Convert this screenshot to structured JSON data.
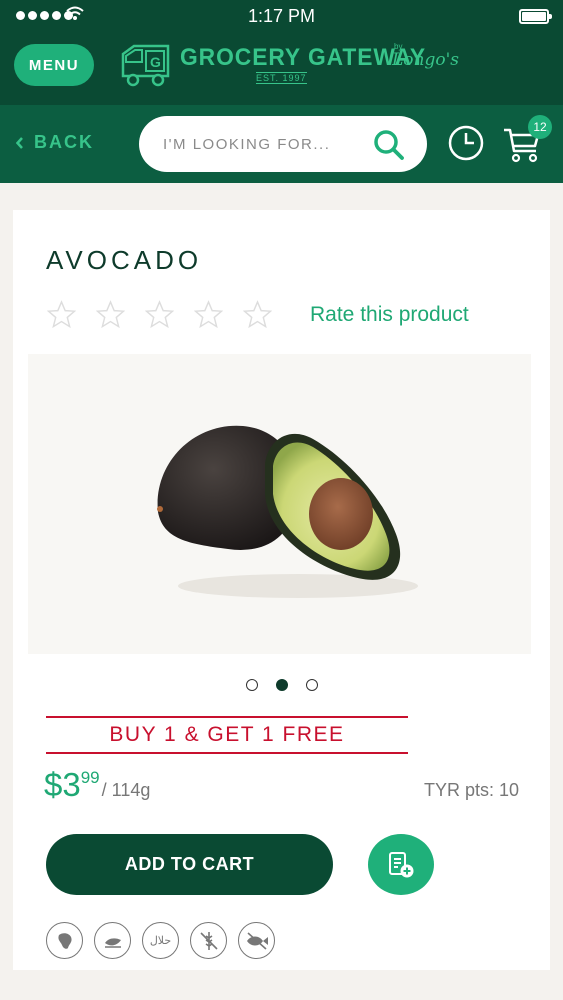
{
  "status_bar": {
    "time": "1:17 PM"
  },
  "header": {
    "menu_label": "MENU",
    "logo": {
      "title": "GROCERY GATEWAY",
      "est": "EST. 1997",
      "by": "by",
      "brand": "Longo's",
      "badge_letter": "G"
    }
  },
  "nav": {
    "back_label": "BACK",
    "search_placeholder": "I'M LOOKING FOR...",
    "cart_count": "12"
  },
  "product": {
    "title": "AVOCADO",
    "rating": 0,
    "rating_max": 5,
    "rate_label": "Rate this product",
    "carousel": {
      "count": 3,
      "active": 2
    },
    "promo": "BUY 1 & GET 1 FREE",
    "price_dollars": "$3",
    "price_cents": "99",
    "price_unit": "/ 114g",
    "points": "TYR pts: 10",
    "add_to_cart": "ADD TO CART",
    "attributes": [
      "ontario-icon",
      "vegan-icon",
      "halal-icon",
      "gluten-free-icon",
      "fish-free-icon"
    ],
    "attribute_halal_text": "حلال"
  },
  "colors": {
    "header": "#0a4a33",
    "nav": "#0c5e41",
    "accent": "#1fb07a",
    "promo": "#c8102e"
  }
}
